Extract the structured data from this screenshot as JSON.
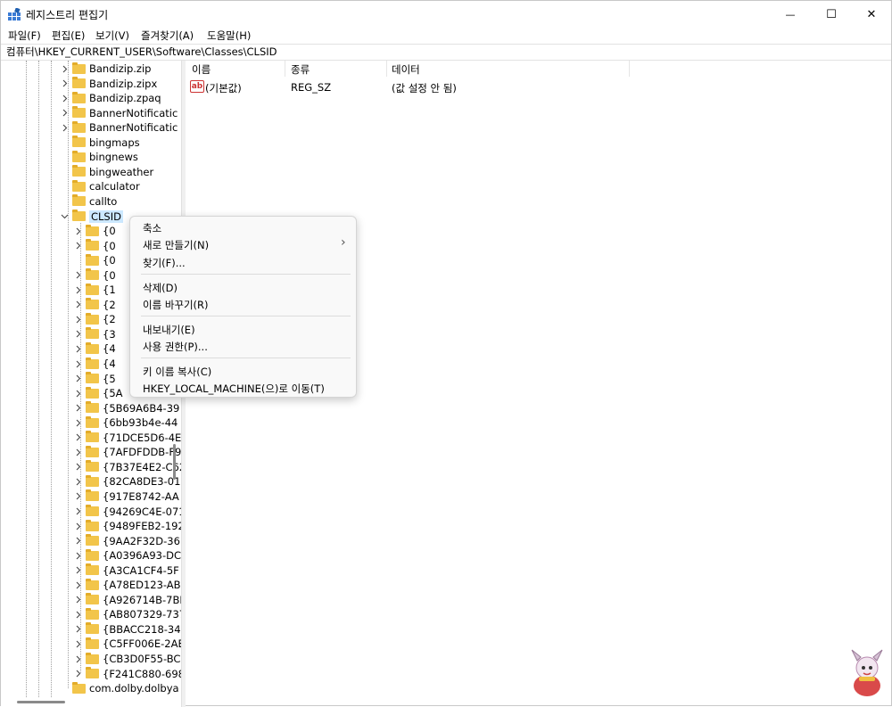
{
  "window": {
    "title": "레지스트리 편집기",
    "caption": {
      "minimize": "—",
      "maximize": "☐",
      "close": "✕"
    }
  },
  "menubar": [
    "파일(F)",
    "편집(E)",
    "보기(V)",
    "즐겨찾기(A)",
    "도움말(H)"
  ],
  "address": "컴퓨터\\HKEY_CURRENT_USER\\Software\\Classes\\CLSID",
  "tree": {
    "items": [
      "Bandizip.zip",
      "Bandizip.zipx",
      "Bandizip.zpaq",
      "BannerNotificatic",
      "BannerNotificatic",
      "bingmaps",
      "bingnews",
      "bingweather",
      "calculator",
      "callto",
      "CLSID"
    ],
    "clsid_children": [
      "{0",
      "{0",
      "{0",
      "{0",
      "{1",
      "{2",
      "{2",
      "{3",
      "{4",
      "{4",
      "{5",
      "{5A",
      "{5B69A6B4-39",
      "{6bb93b4e-44",
      "{71DCE5D6-4E",
      "{7AFDFDDB-F9",
      "{7B37E4E2-C62",
      "{82CA8DE3-01",
      "{917E8742-AA",
      "{94269C4E-071",
      "{9489FEB2-192",
      "{9AA2F32D-36",
      "{A0396A93-DC",
      "{A3CA1CF4-5F",
      "{A78ED123-AB",
      "{A926714B-7BI",
      "{AB807329-737",
      "{BBACC218-34",
      "{C5FF006E-2AE",
      "{CB3D0F55-BC",
      "{F241C880-698"
    ],
    "after": "com.dolby.dolbya"
  },
  "list": {
    "columns": [
      "이름",
      "종류",
      "데이터"
    ],
    "rows": [
      {
        "icon": "ab",
        "name": "(기본값)",
        "type": "REG_SZ",
        "data": "(값 설정 안 됨)"
      }
    ]
  },
  "context_menu": {
    "items": [
      "축소",
      "새로 만들기(N)",
      "찾기(F)...",
      "삭제(D)",
      "이름 바꾸기(R)",
      "내보내기(E)",
      "사용 권한(P)...",
      "키 이름 복사(C)",
      "HKEY_LOCAL_MACHINE(으)로 이동(T)"
    ],
    "submenu_arrow": "›"
  },
  "colors": {
    "folder": "#f2c54a",
    "selection": "#cce8ff",
    "menu_bg": "#f9f9f9"
  },
  "icons": [
    "registry-editor-icon",
    "folder-icon",
    "chevron-right-icon",
    "chevron-down-icon",
    "string-value-icon"
  ]
}
